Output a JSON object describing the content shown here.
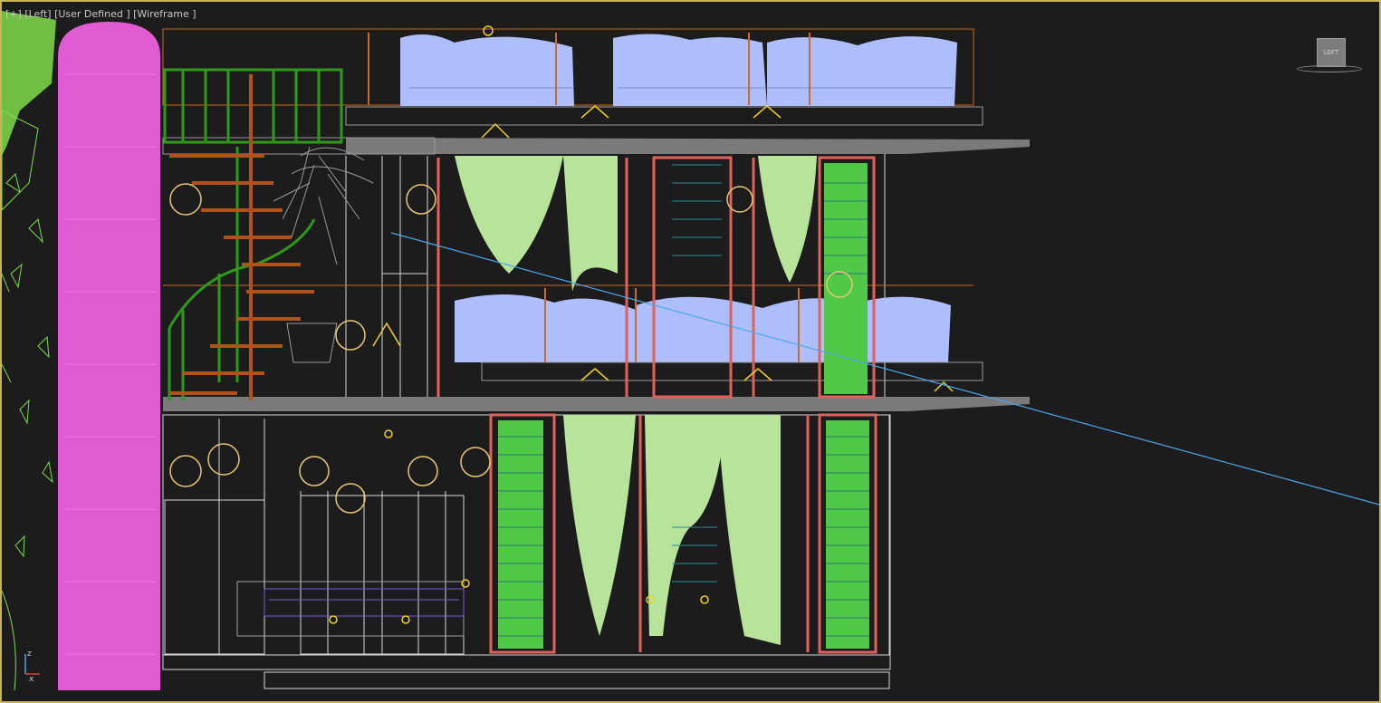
{
  "viewport": {
    "label": "[+] [Left] [User Defined ] [Wireframe ]",
    "border_color": "#c8b35a",
    "background": "#1c1c1c"
  },
  "viewcube": {
    "face_label": "LEFT"
  },
  "axis_gizmo": {
    "z_label": "z",
    "x_label": "x"
  },
  "scene_colors": {
    "pink_column": "#e05ad2",
    "plants": "#7fdc4a",
    "cushions": "#aebdfb",
    "curtains": "#b7e49a",
    "stair_green": "#2e9a1a",
    "stair_brown": "#b0521a",
    "railing_orange": "#c96a2a",
    "frames_red": "#e0605a",
    "shutters_green": "#50c848",
    "slab_grey": "#7a7a7a",
    "wire_white": "#d8d8d8",
    "lamp_gold": "#e6c878",
    "light_yellow": "#f0d020",
    "camera_line": "#4aa8e8",
    "tree_grey": "#9a9a9a"
  }
}
